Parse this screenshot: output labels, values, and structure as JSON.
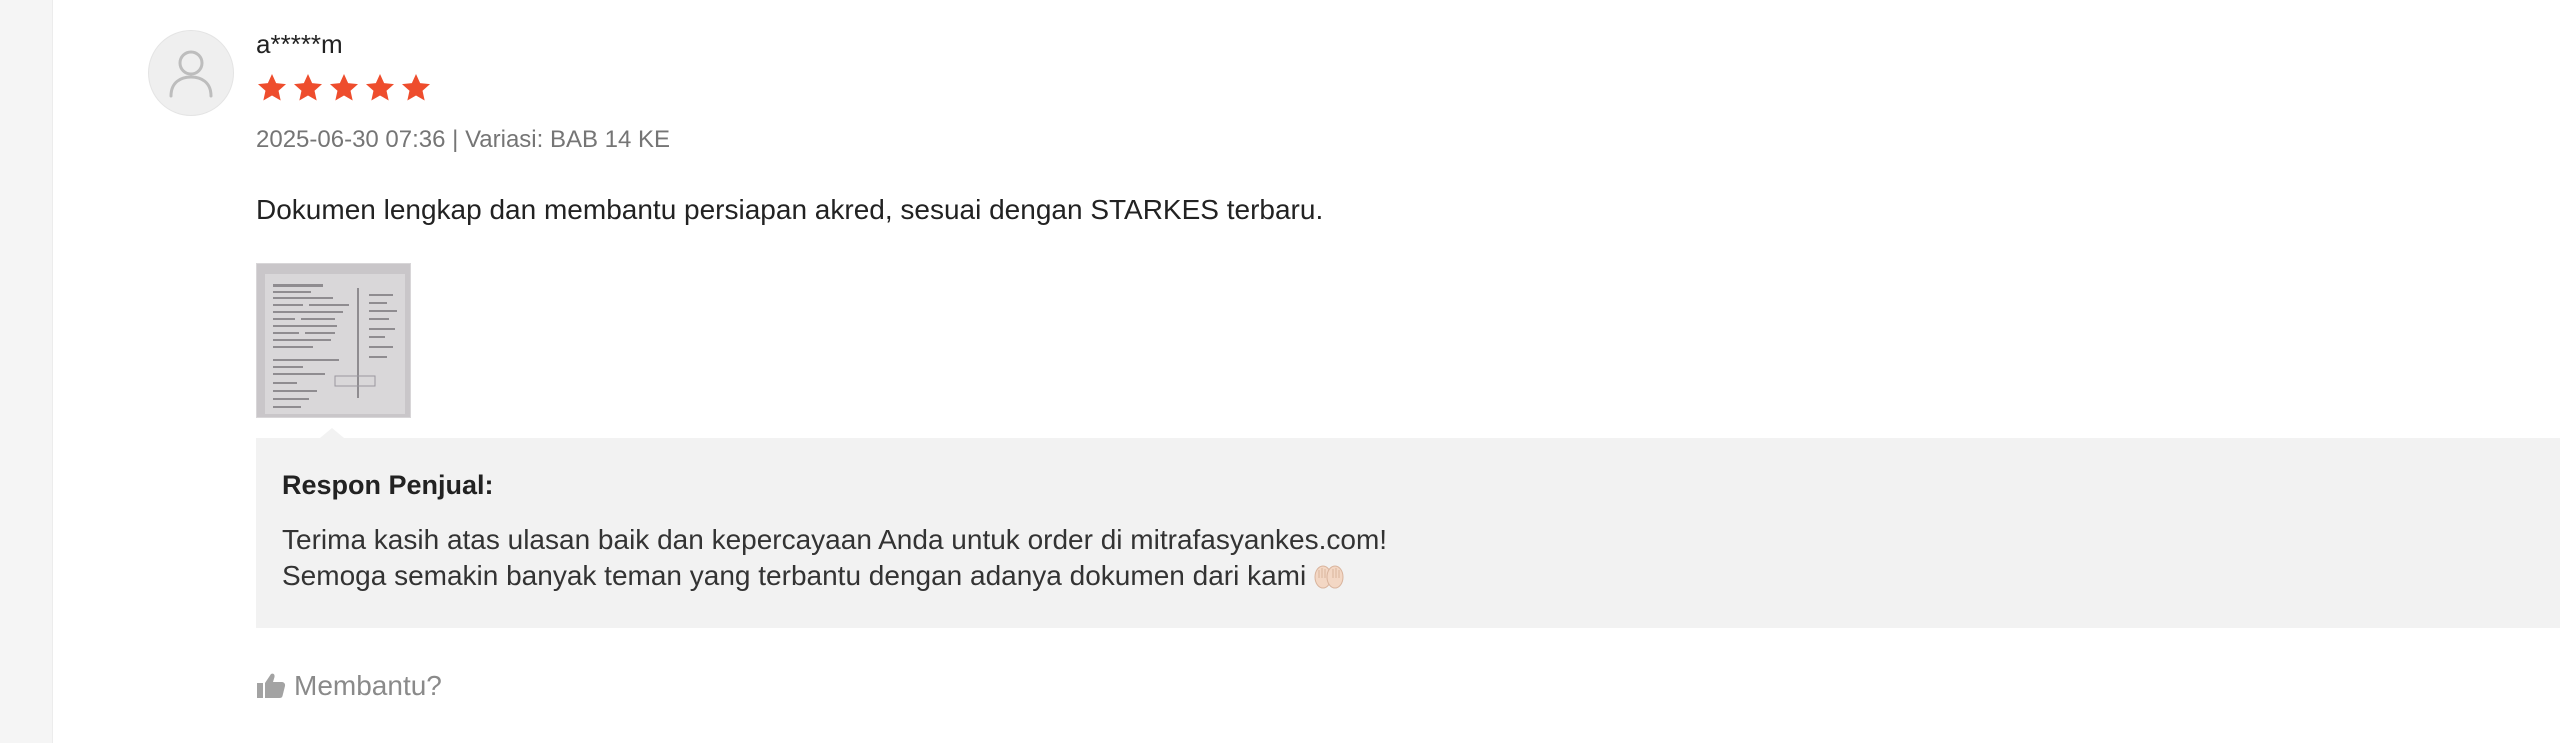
{
  "review": {
    "username": "a*****m",
    "rating": 5,
    "rating_max": 5,
    "meta": "2025-06-30 07:36 | Variasi: BAB 14 KE",
    "comment": "Dokumen lengkap dan membantu persiapan akred, sesuai dengan STARKES terbaru."
  },
  "seller_response": {
    "title": "Respon Penjual:",
    "line1": "Terima kasih atas ulasan baik dan kepercayaan Anda untuk order di mitrafasyankes.com!",
    "line2": "Semoga semakin banyak teman yang terbantu dengan adanya dokumen dari kami"
  },
  "actions": {
    "helpful_label": "Membantu?"
  },
  "icons": {
    "avatar": "user-avatar-icon",
    "star": "star-icon",
    "helpful": "thumbs-up-icon",
    "more": "more-vertical-icon",
    "emoji": "open-hands-emoji"
  },
  "colors": {
    "star": "#ee4d2d",
    "reply_background": "#f2f2f2",
    "muted_text": "#757575"
  }
}
